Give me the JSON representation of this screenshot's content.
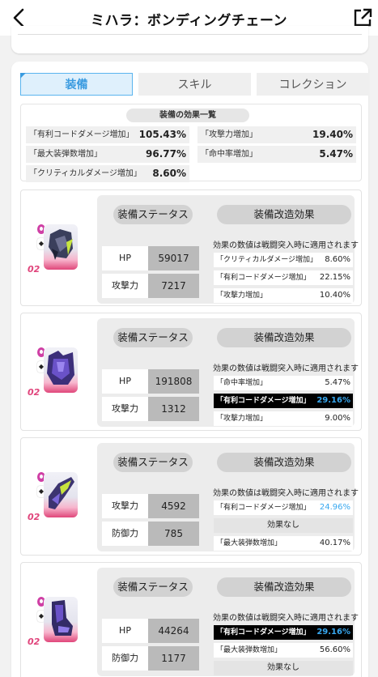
{
  "header": {
    "title": "ミハラ：ボンディングチェーン"
  },
  "tabs": [
    {
      "label": "装備",
      "active": true
    },
    {
      "label": "スキル",
      "active": false
    },
    {
      "label": "コレクション",
      "active": false
    }
  ],
  "effects": {
    "title": "装備の効果一覧",
    "items": [
      {
        "label": "「有利コードダメージ増加」",
        "value": "105.43%"
      },
      {
        "label": "「攻撃力増加」",
        "value": "19.40%"
      },
      {
        "label": "「最大装弾数増加」",
        "value": "96.77%"
      },
      {
        "label": "「命中率増加」",
        "value": "5.47%"
      },
      {
        "label": "「クリティカルダメージ増加」",
        "value": "8.60%"
      }
    ]
  },
  "colors": {
    "accent": "#3a9be0",
    "highlight_value": "#38a8f0",
    "level_pink": "#e0447b"
  },
  "equipment": [
    {
      "level": "02",
      "status_label": "装備ステータス",
      "mod_label": "装備改造効果",
      "note": "効果の数値は戦闘突入時に適用されます",
      "stats": [
        {
          "label": "HP",
          "value": "59017"
        },
        {
          "label": "攻撃力",
          "value": "7217"
        }
      ],
      "mods": [
        {
          "label": "「クリティカルダメージ増加」",
          "value": "8.60%"
        },
        {
          "label": "「有利コードダメージ増加」",
          "value": "22.15%"
        },
        {
          "label": "「攻撃力増加」",
          "value": "10.40%"
        }
      ]
    },
    {
      "level": "02",
      "status_label": "装備ステータス",
      "mod_label": "装備改造効果",
      "note": "効果の数値は戦闘突入時に適用されます",
      "stats": [
        {
          "label": "HP",
          "value": "191808"
        },
        {
          "label": "攻撃力",
          "value": "1312"
        }
      ],
      "mods": [
        {
          "label": "「命中率増加」",
          "value": "5.47%"
        },
        {
          "label": "「有利コードダメージ増加」",
          "value": "29.16%"
        },
        {
          "label": "「攻撃力増加」",
          "value": "9.00%"
        }
      ]
    },
    {
      "level": "02",
      "status_label": "装備ステータス",
      "mod_label": "装備改造効果",
      "note": "効果の数値は戦闘突入時に適用されます",
      "stats": [
        {
          "label": "攻撃力",
          "value": "4592"
        },
        {
          "label": "防御力",
          "value": "785"
        }
      ],
      "mods": [
        {
          "label": "「有利コードダメージ増加」",
          "value": "24.96%"
        },
        {
          "label": "効果なし",
          "value": ""
        },
        {
          "label": "「最大装弾数増加」",
          "value": "40.17%"
        }
      ]
    },
    {
      "level": "02",
      "status_label": "装備ステータス",
      "mod_label": "装備改造効果",
      "note": "効果の数値は戦闘突入時に適用されます",
      "stats": [
        {
          "label": "HP",
          "value": "44264"
        },
        {
          "label": "防御力",
          "value": "1177"
        }
      ],
      "mods": [
        {
          "label": "「有利コードダメージ増加」",
          "value": "29.16%"
        },
        {
          "label": "「最大装弾数増加」",
          "value": "56.60%"
        },
        {
          "label": "効果なし",
          "value": ""
        }
      ]
    }
  ]
}
